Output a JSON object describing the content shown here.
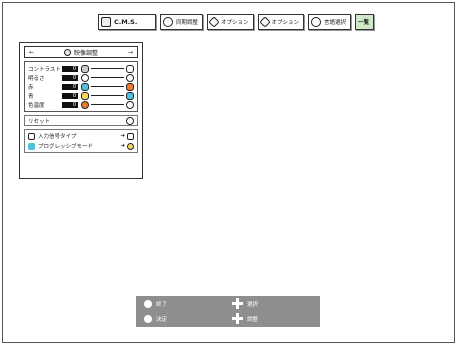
{
  "tabs": [
    {
      "label": "C.M.S.",
      "icon": "cms-icon",
      "active": false
    },
    {
      "label": "同期調整",
      "icon": "sync-icon",
      "active": false
    },
    {
      "label": "オプション",
      "icon": "option-icon",
      "active": false
    },
    {
      "label": "オプション",
      "icon": "option2-icon",
      "active": false
    },
    {
      "label": "言語選択",
      "icon": "language-icon",
      "active": false
    },
    {
      "label": "一覧",
      "icon": "",
      "active": true
    }
  ],
  "panel": {
    "title": "映像調整",
    "left_arrow": "←",
    "right_arrow": "→",
    "adjustments": [
      {
        "label": "コントラスト",
        "value": "0"
      },
      {
        "label": "明るさ",
        "value": "0"
      },
      {
        "label": "赤",
        "value": "0"
      },
      {
        "label": "青",
        "value": "0"
      },
      {
        "label": "色温度",
        "value": "0"
      }
    ],
    "reset_label": "リセット",
    "options": [
      {
        "label": "入力信号タイプ",
        "arrow": "➜"
      },
      {
        "label": "プログレッシブモード",
        "arrow": "➜"
      }
    ]
  },
  "help": {
    "exit": "終了",
    "select": "選択",
    "enter": "決定",
    "adjust": "調整"
  },
  "colors": {
    "active_tab": "#cfe9c8",
    "help_bar": "#8e8e8e",
    "red_knob": "#f07a2e",
    "cyan_knob": "#4fc3d9",
    "yellow_knob": "#f6d65a"
  }
}
